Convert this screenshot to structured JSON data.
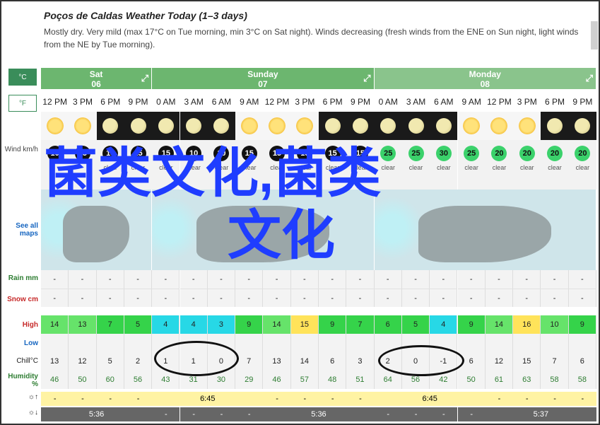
{
  "header": {
    "title": "Poços de Caldas Weather Today (1–3 days)",
    "description": "Mostly dry. Very mild (max 17°C on Tue morning, min 3°C on Sat night). Winds decreasing (fresh winds from the ENE on Sun night, light winds from the NE by Tue morning)."
  },
  "units": {
    "celsius": "°C",
    "fahrenheit": "°F"
  },
  "labels": {
    "wind": "Wind km/h",
    "maps": "See all maps",
    "rain": "Rain mm",
    "snow": "Snow cm",
    "high": "High",
    "low": "Low",
    "chill": "Chill°C",
    "humidity": "Humidity %"
  },
  "days": [
    {
      "name": "Sat",
      "date": "06"
    },
    {
      "name": "Sunday",
      "date": "07"
    },
    {
      "name": "Monday",
      "date": "08"
    }
  ],
  "times": [
    "12 PM",
    "3 PM",
    "6 PM",
    "9 PM",
    "0 AM",
    "3 AM",
    "6 AM",
    "9 AM",
    "12 PM",
    "3 PM",
    "6 PM",
    "9 PM",
    "0 AM",
    "3 AM",
    "6 AM",
    "9 AM",
    "12 PM",
    "3 PM",
    "6 PM",
    "9 PM"
  ],
  "icons": [
    "sun",
    "sun",
    "moon",
    "moon",
    "moon",
    "moon",
    "moon",
    "sun",
    "sun",
    "sun",
    "moon",
    "moon",
    "moon",
    "moon",
    "moon",
    "sun",
    "sun",
    "sun",
    "moon",
    "moon"
  ],
  "wind": [
    "10",
    "15",
    "15",
    "15",
    "15",
    "10",
    "10",
    "15",
    "15",
    "15",
    "15",
    "15",
    "25",
    "25",
    "30",
    "25",
    "20",
    "20",
    "20",
    "20"
  ],
  "wind_cond": [
    "",
    "",
    "clear",
    "clear",
    "clear",
    "clear",
    "clear",
    "clear",
    "clear",
    "clear",
    "clear",
    "clear",
    "clear",
    "clear",
    "clear",
    "clear",
    "clear",
    "clear",
    "clear",
    "clear"
  ],
  "rain": [
    "-",
    "-",
    "-",
    "-",
    "-",
    "-",
    "-",
    "-",
    "-",
    "-",
    "-",
    "-",
    "-",
    "-",
    "-",
    "-",
    "-",
    "-",
    "-",
    "-"
  ],
  "snow": [
    "-",
    "-",
    "-",
    "-",
    "-",
    "-",
    "-",
    "-",
    "-",
    "-",
    "-",
    "-",
    "-",
    "-",
    "-",
    "-",
    "-",
    "-",
    "-",
    "-"
  ],
  "high": [
    "14",
    "13",
    "7",
    "5",
    "4",
    "4",
    "3",
    "9",
    "14",
    "15",
    "9",
    "7",
    "6",
    "5",
    "4",
    "9",
    "14",
    "16",
    "10",
    "9"
  ],
  "high_colors": [
    "#66e36a",
    "#66e36a",
    "#35d34a",
    "#35d34a",
    "#27d8e6",
    "#27d8e6",
    "#27d8e6",
    "#35d34a",
    "#66e36a",
    "#ffe35a",
    "#35d34a",
    "#35d34a",
    "#35d34a",
    "#35d34a",
    "#27d8e6",
    "#35d34a",
    "#66e36a",
    "#ffe35a",
    "#66e36a",
    "#35d34a"
  ],
  "low": [
    "",
    "",
    "",
    "",
    "",
    "",
    "",
    "",
    "",
    "",
    "",
    "",
    "",
    "",
    "",
    "",
    "",
    "",
    "",
    ""
  ],
  "chill": [
    "13",
    "12",
    "5",
    "2",
    "1",
    "1",
    "0",
    "7",
    "13",
    "14",
    "6",
    "3",
    "2",
    "0",
    "-1",
    "6",
    "12",
    "15",
    "7",
    "6"
  ],
  "humidity": [
    "46",
    "50",
    "60",
    "56",
    "43",
    "31",
    "30",
    "29",
    "46",
    "57",
    "48",
    "51",
    "64",
    "56",
    "42",
    "50",
    "61",
    "63",
    "58",
    "58"
  ],
  "sunrise": [
    "6:45",
    "6:45"
  ],
  "sunset": [
    "5:36",
    "5:36",
    "5:37"
  ],
  "watermark": "菌类文化,菌类文化"
}
